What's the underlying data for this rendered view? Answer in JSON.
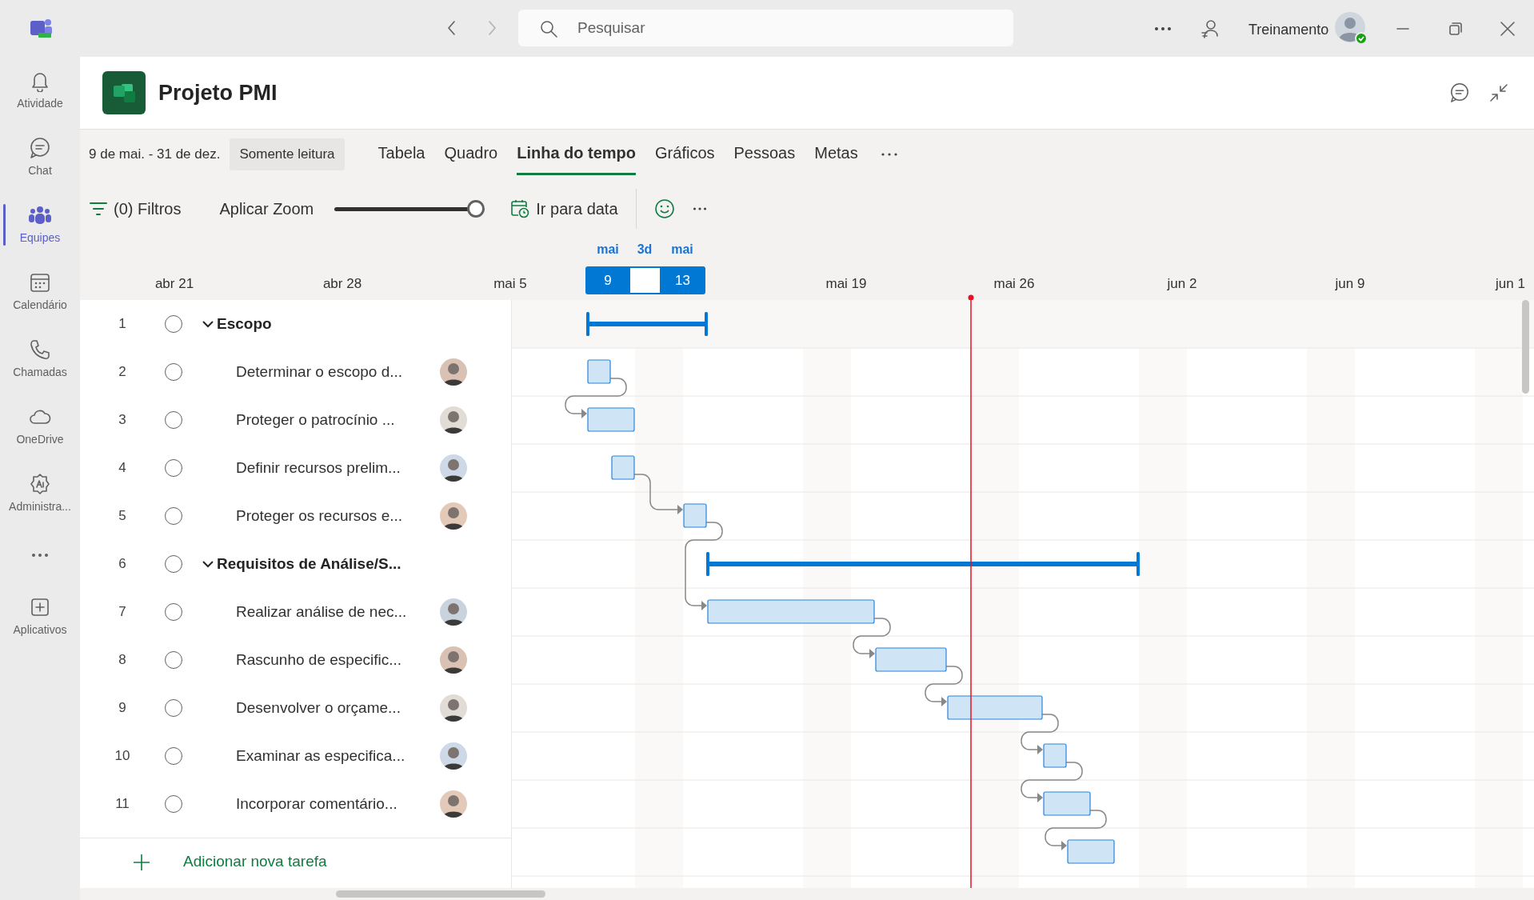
{
  "app_bar": {
    "search": {
      "placeholder": "Pesquisar"
    },
    "user_name": "Treinamento"
  },
  "rail": [
    {
      "label": "Atividade",
      "kind": "bell",
      "selected": false
    },
    {
      "label": "Chat",
      "kind": "chat",
      "selected": false
    },
    {
      "label": "Equipes",
      "kind": "teams",
      "selected": true
    },
    {
      "label": "Calendário",
      "kind": "calendar",
      "selected": false
    },
    {
      "label": "Chamadas",
      "kind": "phone",
      "selected": false
    },
    {
      "label": "OneDrive",
      "kind": "cloud",
      "selected": false
    },
    {
      "label": "Administra...",
      "kind": "admin",
      "selected": false
    },
    {
      "kind": "more",
      "selected": false
    },
    {
      "label": "Aplicativos",
      "kind": "apps",
      "selected": false
    }
  ],
  "project": {
    "title": "Projeto PMI",
    "date_range": "9 de mai. - 31 de dez.",
    "badge": "Somente leitura"
  },
  "tabs": [
    {
      "label": "Tabela",
      "selected": false
    },
    {
      "label": "Quadro",
      "selected": false
    },
    {
      "label": "Linha do tempo",
      "selected": true
    },
    {
      "label": "Gráficos",
      "selected": false
    },
    {
      "label": "Pessoas",
      "selected": false
    },
    {
      "label": "Metas",
      "selected": false
    }
  ],
  "toolbar": {
    "filters": "(0) Filtros",
    "zoom_label": "Aplicar Zoom",
    "zoom": {
      "level": 1
    },
    "go_to_date": "Ir para data"
  },
  "timeline": {
    "selection": {
      "start_month": "mai",
      "start_day": "9",
      "span": "3d",
      "end_month": "mai",
      "end_day": "13"
    },
    "weeks": [
      "abr 21",
      "abr 28",
      "mai 5",
      "mai 19",
      "mai 26",
      "jun 2",
      "jun 9",
      "jun 1"
    ]
  },
  "tasks": [
    {
      "number": "1",
      "title": "Escopo",
      "kind": "summary",
      "expanded": true,
      "checked": false
    },
    {
      "number": "2",
      "title": "Determinar o escopo d...",
      "kind": "task",
      "checked": false
    },
    {
      "number": "3",
      "title": "Proteger o patrocínio ...",
      "kind": "task",
      "checked": false
    },
    {
      "number": "4",
      "title": "Definir recursos prelim...",
      "kind": "task",
      "checked": false
    },
    {
      "number": "5",
      "title": "Proteger os recursos e...",
      "kind": "task",
      "checked": false
    },
    {
      "number": "6",
      "title": "Requisitos de Análise/S...",
      "kind": "summary",
      "expanded": true,
      "checked": false
    },
    {
      "number": "7",
      "title": "Realizar análise de nec...",
      "kind": "task",
      "checked": false
    },
    {
      "number": "8",
      "title": "Rascunho de especific...",
      "kind": "task",
      "checked": false
    },
    {
      "number": "9",
      "title": "Desenvolver o orçame...",
      "kind": "task",
      "checked": false
    },
    {
      "number": "10",
      "title": "Examinar as especifica...",
      "kind": "task",
      "checked": false
    },
    {
      "number": "11",
      "title": "Incorporar comentário...",
      "kind": "task",
      "checked": false
    }
  ],
  "add_task": "Adicionar nova tarefa"
}
